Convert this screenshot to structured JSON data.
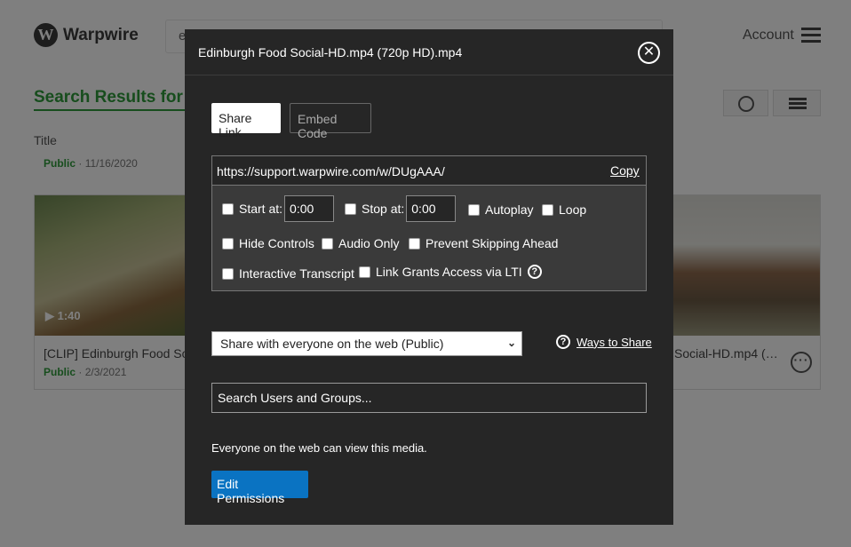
{
  "app": {
    "logo_letter": "W",
    "logo_text": "Warpwire"
  },
  "header": {
    "search_value": "e",
    "account_label": "Account"
  },
  "results": {
    "title": "Search Results for e",
    "column_title": "Title",
    "top_row_visibility": "Public",
    "top_row_date": "· 11/16/2020"
  },
  "cards": [
    {
      "duration": "▶ 1:40",
      "title": "[CLIP] Edinburgh Food Social",
      "visibility": "Public",
      "date": "· 2/3/2021"
    },
    {
      "title": "Social-HD.mp4 (…"
    }
  ],
  "modal": {
    "title": "Edinburgh Food Social-HD.mp4 (720p HD).mp4",
    "tabs": {
      "share": "Share Link",
      "embed": "Embed Code"
    },
    "link_url": "https://support.warpwire.com/w/DUgAAA/",
    "copy_label": "Copy",
    "options": {
      "start_label": "Start at:",
      "start_value": "0:00",
      "stop_label": "Stop at:",
      "stop_value": "0:00",
      "autoplay": "Autoplay",
      "loop": "Loop",
      "hide_controls": "Hide Controls",
      "audio_only": "Audio Only",
      "prevent_skip": "Prevent Skipping Ahead",
      "interactive_transcript": "Interactive Transcript",
      "lti_access": "Link Grants Access via LTI"
    },
    "share_select": "Share with everyone on the web (Public)",
    "ways_to_share": "Ways to Share",
    "search_placeholder": "Search Users and Groups...",
    "description": "Everyone on the web can view this media.",
    "edit_button": "Edit Permissions"
  },
  "colors": {
    "accent_green": "#2e9b3a",
    "modal_bg": "#262626",
    "primary_button": "#0a73c2"
  }
}
